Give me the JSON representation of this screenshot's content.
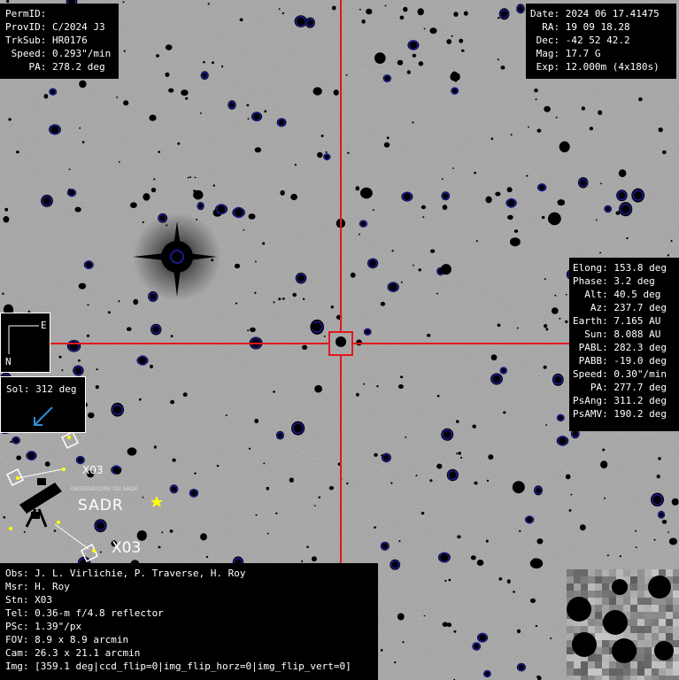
{
  "top_left_panel": [
    "PermID:",
    "ProvID: C/2024 J3",
    "TrkSub: HR0176",
    " Speed: 0.293\"/min",
    "    PA: 278.2 deg"
  ],
  "top_right_panel": [
    "Date: 2024 06 17.41475",
    "  RA: 19 09 18.28",
    " Dec: -42 52 42.2",
    " Mag: 17.7 G",
    " Exp: 12.000m (4x180s)"
  ],
  "right_panel": [
    "Elong: 153.8 deg",
    "Phase: 3.2 deg",
    "  Alt: 40.5 deg",
    "   Az: 237.7 deg",
    "Earth: 7.165 AU",
    "  Sun: 8.088 AU",
    " PABL: 282.3 deg",
    " PABB: -19.0 deg",
    "Speed: 0.30\"/min",
    "   PA: 277.7 deg",
    "PsAng: 311.2 deg",
    "PsAMV: 190.2 deg"
  ],
  "bottom_left_panel": [
    "Obs: J. L. Virlichie, P. Traverse, H. Roy",
    "Msr: H. Roy",
    "Stn: X03",
    "Tel: 0.36-m f/4.8 reflector",
    "PSc: 1.39\"/px",
    "FOV: 8.9 x 8.9 arcmin",
    "Cam: 26.3 x 21.1 arcmin",
    "Img: [359.1 deg|ccd_flip=0|img_flip_horz=0|img_flip_vert=0]"
  ],
  "compass": {
    "east": "E",
    "north": "N"
  },
  "sol": {
    "label": "Sol: 312 deg",
    "arrow_color": "#2f8fd8"
  },
  "logo": {
    "name": "SADR",
    "caption": "OBSERVATOIRE DU SADR",
    "station_small": "X03",
    "station_big": "X03"
  },
  "colors": {
    "crosshair": "#e0191c",
    "circle": "#1a1a8c",
    "panel_bg": "#000000",
    "panel_text": "#ffffff",
    "sky": "#9a9a9a"
  }
}
